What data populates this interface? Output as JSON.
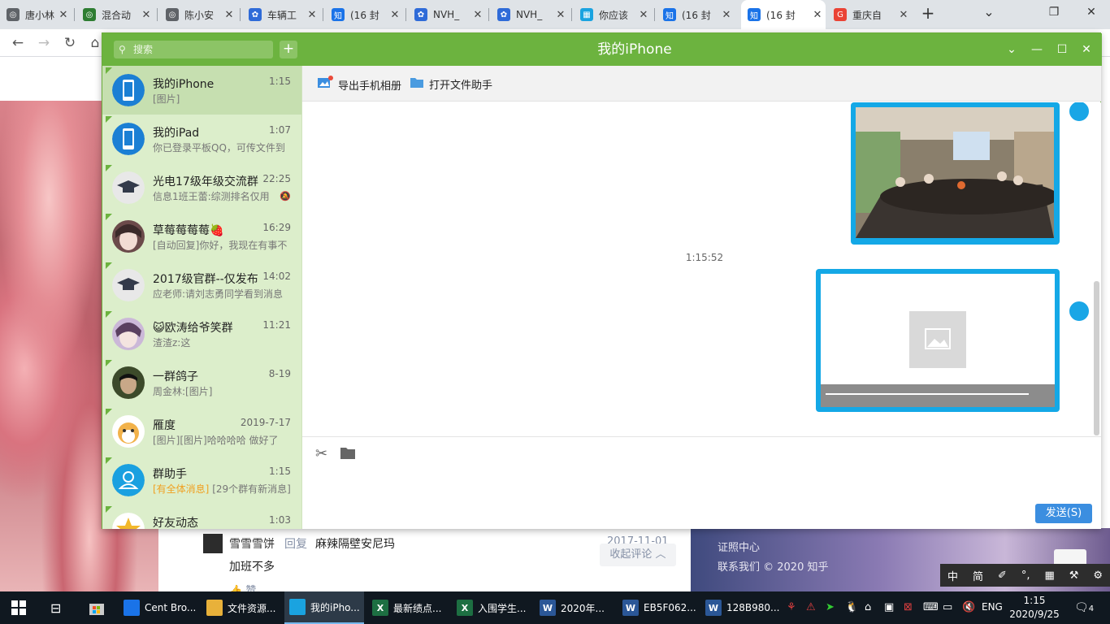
{
  "browser": {
    "tabs": [
      {
        "title": "唐小林",
        "icon": "globe",
        "color": "#5f6368",
        "active": false
      },
      {
        "title": "混合动",
        "icon": "globe",
        "color": "#2e7d32",
        "active": false
      },
      {
        "title": "陈小安",
        "icon": "globe",
        "color": "#5f6368",
        "active": false
      },
      {
        "title": "车辆工",
        "icon": "baidu",
        "color": "#2f6bd8",
        "active": false
      },
      {
        "title": "(16 封",
        "icon": "zhihu",
        "color": "#1a73e8",
        "active": false
      },
      {
        "title": "NVH_",
        "icon": "baidu",
        "color": "#2f6bd8",
        "active": false
      },
      {
        "title": "NVH_",
        "icon": "baidu",
        "color": "#2f6bd8",
        "active": false
      },
      {
        "title": "你应该",
        "icon": "calendar",
        "color": "#1aa3e0",
        "active": false
      },
      {
        "title": "(16 封",
        "icon": "zhihu",
        "color": "#1a73e8",
        "active": false
      },
      {
        "title": "(16 封",
        "icon": "zhihu",
        "color": "#1a73e8",
        "active": true
      },
      {
        "title": "重庆自",
        "icon": "google",
        "color": "#ea4335",
        "active": false
      }
    ],
    "new_tab": "+",
    "dropdown": "⌄",
    "min": "—",
    "restore": "❐",
    "close": "✕"
  },
  "page": {
    "comment": {
      "name": "雪雪雪饼",
      "reply": "回复",
      "text": "麻辣隔壁安尼玛",
      "date": "2017-11-01",
      "body": "加班不多",
      "collapse": "收起评论 ︿",
      "like": "👍 赞"
    },
    "links": [
      "证照中心",
      "联系我们 © 2020 知乎"
    ]
  },
  "ime": [
    "中",
    "简",
    "✐",
    "°,",
    "▦",
    "⚒",
    "⚙"
  ],
  "qq": {
    "search_placeholder": "搜索",
    "plus": "+",
    "title": "我的iPhone",
    "controls": [
      "⌄",
      "—",
      "☐",
      "✕"
    ],
    "conversations": [
      {
        "name": "我的iPhone",
        "time": "1:15",
        "preview": "[图片]",
        "avatar": "phone",
        "selected": true
      },
      {
        "name": "我的iPad",
        "time": "1:07",
        "preview": "你已登录平板QQ，可传文件到",
        "avatar": "phone"
      },
      {
        "name": "光电17级年级交流群",
        "time": "22:25",
        "preview": "信息1班王蕾:综测排名仅用",
        "avatar": "cap",
        "muted": true
      },
      {
        "name": "草莓莓莓莓🍓",
        "time": "16:29",
        "preview": "[自动回复]你好，我现在有事不",
        "avatar": "anime1"
      },
      {
        "name": "2017级官群--仅发布",
        "time": "14:02",
        "preview": "应老师:请刘志勇同学看到消息",
        "avatar": "cap"
      },
      {
        "name": "😺欧涛给爷笑群",
        "time": "11:21",
        "preview": "渣渣z:这",
        "avatar": "anime2"
      },
      {
        "name": "一群鸽子",
        "time": "8-19",
        "preview": "周金林:[图片]",
        "avatar": "photo"
      },
      {
        "name": "雁度",
        "time": "2019-7-17",
        "preview": "[图片][图片]哈哈哈哈 做好了",
        "avatar": "dog"
      },
      {
        "name": "群助手",
        "time": "1:15",
        "preview_hl": "[有全体消息]",
        "preview": " [29个群有新消息]",
        "avatar": "helper"
      },
      {
        "name": "好友动态",
        "time": "1:03",
        "preview": "",
        "avatar": "star"
      }
    ],
    "toolbar": {
      "export": "导出手机相册",
      "open_helper": "打开文件助手"
    },
    "message_time": "1:15:52",
    "send": "发送(S)"
  },
  "taskbar": {
    "apps": [
      {
        "label": "Cent Bro...",
        "icon": "browser",
        "color": "#1a73e8"
      },
      {
        "label": "文件资源...",
        "icon": "folder",
        "color": "#e8b13a"
      },
      {
        "label": "我的iPho...",
        "icon": "phone",
        "color": "#1aa3e0",
        "active": true
      },
      {
        "label": "最新绩点...",
        "icon": "X",
        "color": "#1d6f42"
      },
      {
        "label": "入围学生...",
        "icon": "X",
        "color": "#1d6f42"
      },
      {
        "label": "2020年...",
        "icon": "W",
        "color": "#2b5797"
      },
      {
        "label": "EB5F062...",
        "icon": "W",
        "color": "#2b5797"
      },
      {
        "label": "128B980...",
        "icon": "W",
        "color": "#2b5797"
      }
    ],
    "lang": "ENG",
    "time": "1:15",
    "date": "2020/9/25",
    "notifications": "4"
  }
}
